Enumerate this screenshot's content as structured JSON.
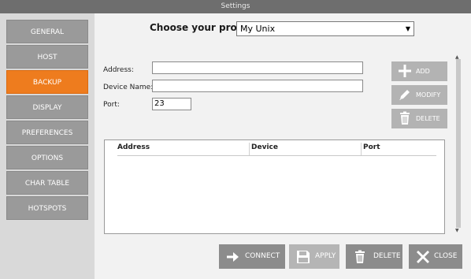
{
  "window": {
    "title": "Settings"
  },
  "sidebar": {
    "items": [
      {
        "label": "GENERAL"
      },
      {
        "label": "HOST"
      },
      {
        "label": "BACKUP"
      },
      {
        "label": "DISPLAY"
      },
      {
        "label": "PREFERENCES"
      },
      {
        "label": "OPTIONS"
      },
      {
        "label": "CHAR TABLE"
      },
      {
        "label": "HOTSPOTS"
      }
    ],
    "active_item": "BACKUP",
    "colors": {
      "active": "#ee7c1e",
      "inactive": "#9a9a9a"
    }
  },
  "profile": {
    "label": "Choose your profile:",
    "value": "My Unix",
    "icon": "dropdown-arrow-icon"
  },
  "form": {
    "address": {
      "label": "Address:",
      "value": ""
    },
    "device_name": {
      "label": "Device Name:",
      "value": ""
    },
    "port": {
      "label": "Port:",
      "value": "23"
    }
  },
  "actions": {
    "add": {
      "label": "ADD",
      "icon": "plus-icon"
    },
    "modify": {
      "label": "MODIFY",
      "icon": "pencil-icon"
    },
    "delete": {
      "label": "DELETE",
      "icon": "trash-icon"
    }
  },
  "table": {
    "columns": [
      "Address",
      "Device",
      "Port"
    ],
    "rows": []
  },
  "footer": {
    "connect": {
      "label": "CONNECT",
      "icon": "arrow-right-icon"
    },
    "apply": {
      "label": "APPLY",
      "icon": "floppy-disk-icon"
    },
    "delete": {
      "label": "DELETE",
      "icon": "trash-icon"
    },
    "close": {
      "label": "CLOSE",
      "icon": "close-x-icon"
    }
  }
}
